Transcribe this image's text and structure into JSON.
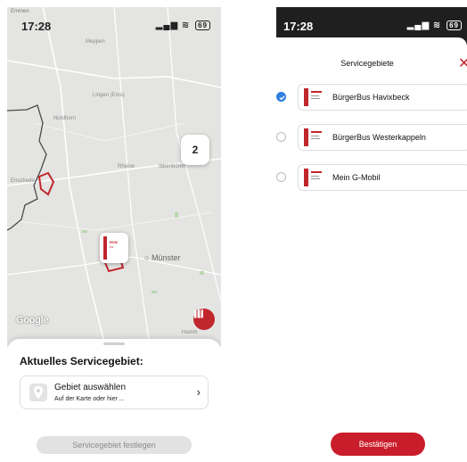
{
  "left_screen": {
    "status_bar": {
      "time": "17:28",
      "battery": "69"
    },
    "map": {
      "top_label": "Emmen",
      "labels": [
        "Meppen",
        "Lingen (Ems)",
        "Nordhorn",
        "Rheine",
        "Ibbenbüren",
        "Enschede",
        "Münster",
        "Hamm"
      ],
      "cluster_count": "2",
      "google_logo": "Google"
    },
    "sheet": {
      "title": "Aktuelles Servicegebiet:",
      "select_title": "Gebiet auswählen",
      "select_subtitle": "Auf der Karte oder hier ...",
      "set_button": "Servicegebiet festlegen"
    }
  },
  "right_screen": {
    "status_bar": {
      "time": "17:28",
      "battery": "69"
    },
    "title": "Servicegebiete",
    "options": [
      {
        "label": "BürgerBus Havixbeck",
        "selected": true
      },
      {
        "label": "BürgerBus Westerkappeln",
        "selected": false
      },
      {
        "label": "Mein G-Mobil",
        "selected": false
      }
    ],
    "confirm_button": "Bestätigen"
  },
  "colors": {
    "accent": "#c91d2b",
    "radio_selected": "#2f80e0",
    "map_bg": "#e4e4e2"
  }
}
